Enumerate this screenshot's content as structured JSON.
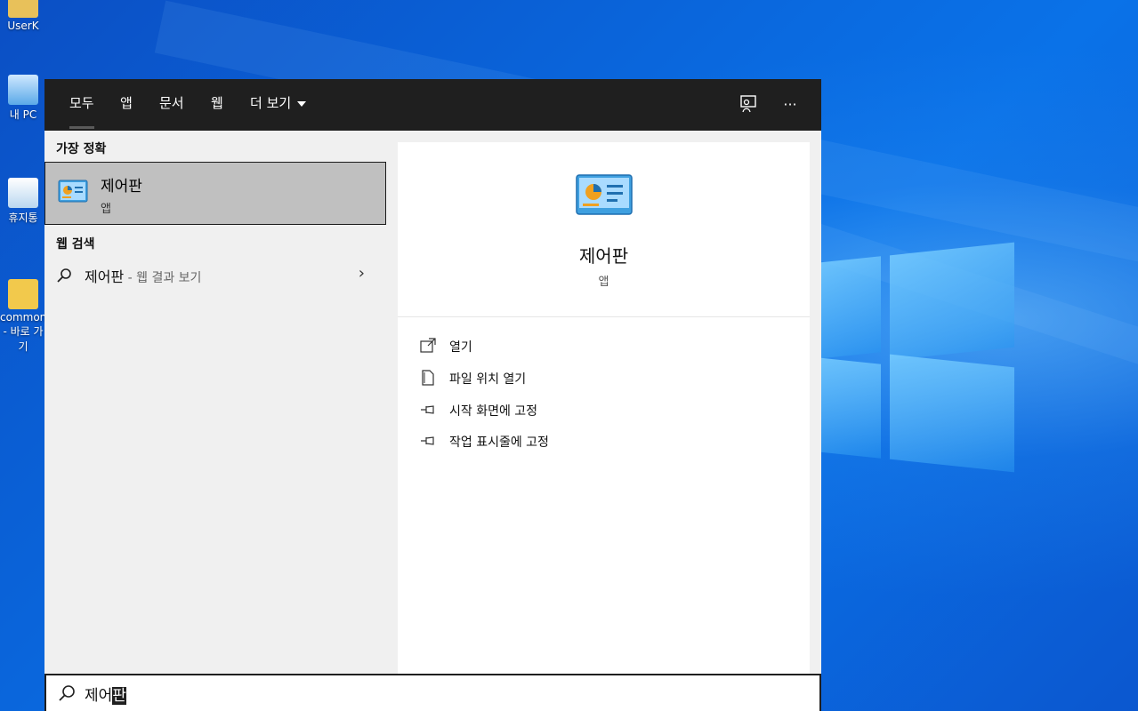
{
  "desktop": {
    "icons": [
      {
        "label": "UserK"
      },
      {
        "label": "내 PC"
      },
      {
        "label": "휴지통"
      },
      {
        "label": "common - 바로 가기"
      }
    ]
  },
  "search": {
    "tabs": [
      {
        "label": "모두"
      },
      {
        "label": "앱"
      },
      {
        "label": "문서"
      },
      {
        "label": "웹"
      },
      {
        "label": "더 보기"
      }
    ],
    "best_match_label": "가장 정확",
    "best_match": {
      "title": "제어판",
      "subtitle": "앱"
    },
    "web_search_label": "웹 검색",
    "web_result": {
      "query": "제어판",
      "hint": " - 웹 결과 보기"
    },
    "detail": {
      "name": "제어판",
      "type": "앱",
      "actions": [
        {
          "label": "열기",
          "icon": "open-icon"
        },
        {
          "label": "파일 위치 열기",
          "icon": "file-location-icon"
        },
        {
          "label": "시작 화면에 고정",
          "icon": "pin-icon"
        },
        {
          "label": "작업 표시줄에 고정",
          "icon": "pin-icon"
        }
      ]
    },
    "input": {
      "typed_prefix": "제어",
      "composing": "판"
    }
  },
  "colors": {
    "topbar": "#1f1f1f",
    "panel": "#f0f0f0",
    "selection": "#c0c0c0",
    "accent": "#0a72e8"
  }
}
